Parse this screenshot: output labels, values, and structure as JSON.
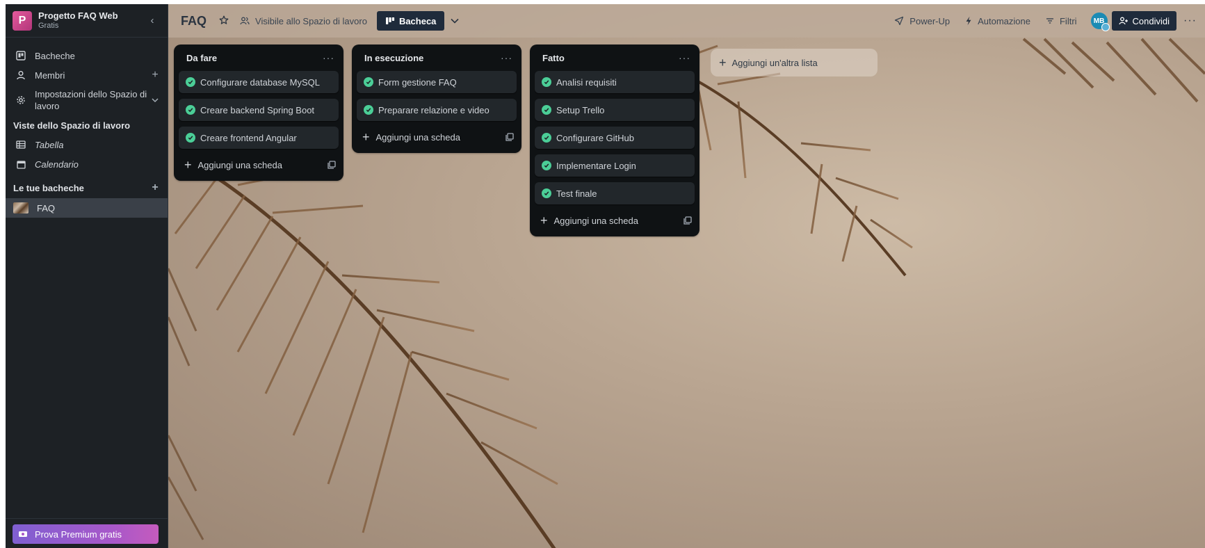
{
  "workspace": {
    "logo_letter": "P",
    "name": "Progetto FAQ Web",
    "plan": "Gratis"
  },
  "sidebar": {
    "items": [
      {
        "label": "Bacheche",
        "icon": "board-icon"
      },
      {
        "label": "Membri",
        "icon": "person-icon"
      },
      {
        "label": "Impostazioni dello Spazio di lavoro",
        "icon": "gear-icon"
      }
    ],
    "views_title": "Viste dello Spazio di lavoro",
    "views": [
      {
        "label": "Tabella",
        "icon": "table-icon"
      },
      {
        "label": "Calendario",
        "icon": "calendar-icon"
      }
    ],
    "boards_title": "Le tue bacheche",
    "boards": [
      {
        "label": "FAQ"
      }
    ],
    "premium_label": "Prova Premium gratis"
  },
  "header": {
    "title": "FAQ",
    "visibility": "Visibile allo Spazio di lavoro",
    "view_label": "Bacheca",
    "powerup": "Power-Up",
    "automation": "Automazione",
    "filters": "Filtri",
    "avatar_initials": "MB",
    "share": "Condividi"
  },
  "lists": [
    {
      "title": "Da fare",
      "cards": [
        "Configurare database MySQL",
        "Creare backend Spring Boot",
        "Creare frontend Angular"
      ],
      "add_label": "Aggiungi una scheda"
    },
    {
      "title": "In esecuzione",
      "cards": [
        "Form gestione FAQ",
        "Preparare relazione e video"
      ],
      "add_label": "Aggiungi una scheda"
    },
    {
      "title": "Fatto",
      "cards": [
        "Analisi requisiti",
        "Setup Trello",
        "Configurare GitHub",
        "Implementare Login",
        "Test finale"
      ],
      "add_label": "Aggiungi una scheda"
    }
  ],
  "add_list_label": "Aggiungi un'altra lista",
  "colors": {
    "sidebar_bg": "#1d2125",
    "list_bg": "#0f1214",
    "card_bg": "#22272b",
    "check_green": "#4bce97",
    "accent_dark": "#1f2b3b",
    "premium_gradient_start": "#7f5fd1",
    "premium_gradient_end": "#c55bbd"
  }
}
